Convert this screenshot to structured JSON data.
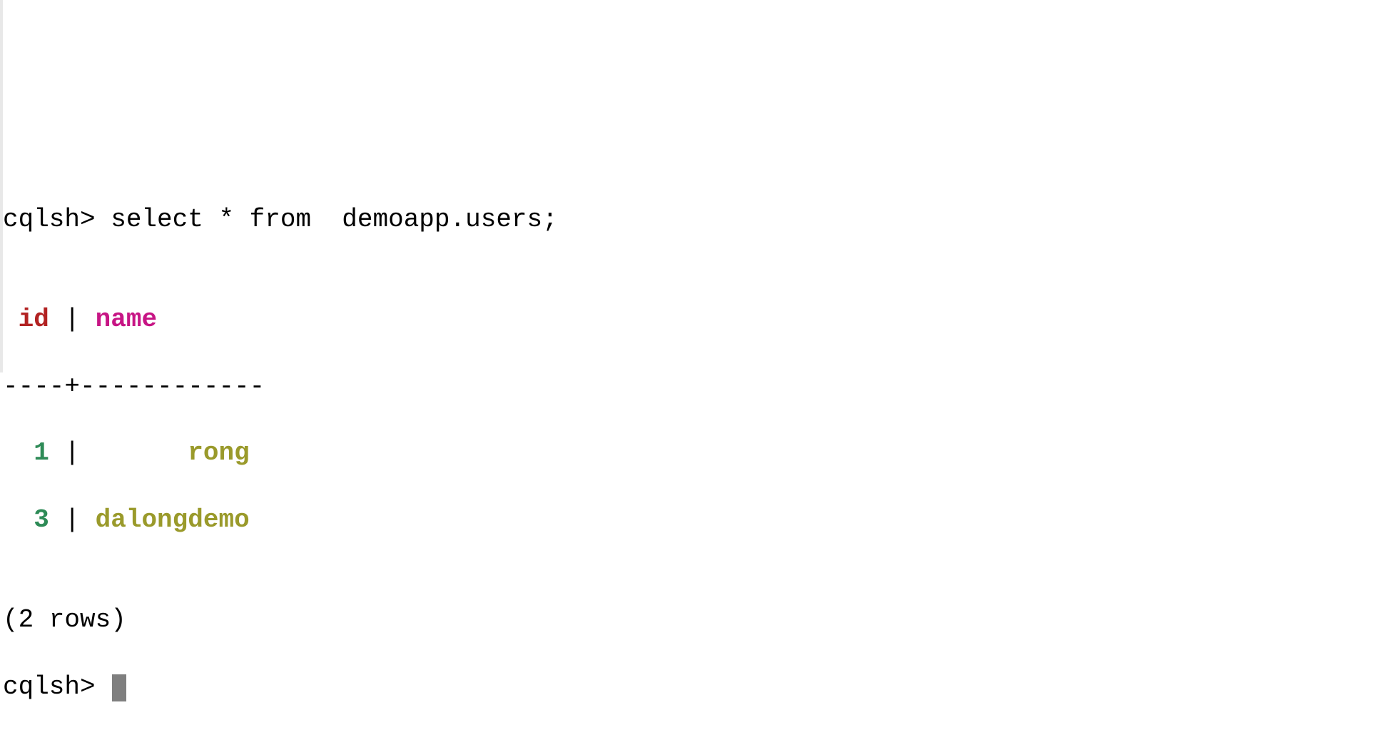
{
  "prompt": "cqlsh>",
  "query": " select * from  demoapp.users;",
  "blank": "",
  "header": {
    "leading": " ",
    "id": "id",
    "sep": " | ",
    "name": "name"
  },
  "divider": "----+------------",
  "rows": [
    {
      "id_pad": "  ",
      "id": "1",
      "sep": " | ",
      "val_pad": "      ",
      "val": "rong"
    },
    {
      "id_pad": "  ",
      "id": "3",
      "sep": " | ",
      "val_pad": "",
      "val": "dalongdemo"
    }
  ],
  "rowcount": "(2 rows)",
  "prompt2": "cqlsh> "
}
